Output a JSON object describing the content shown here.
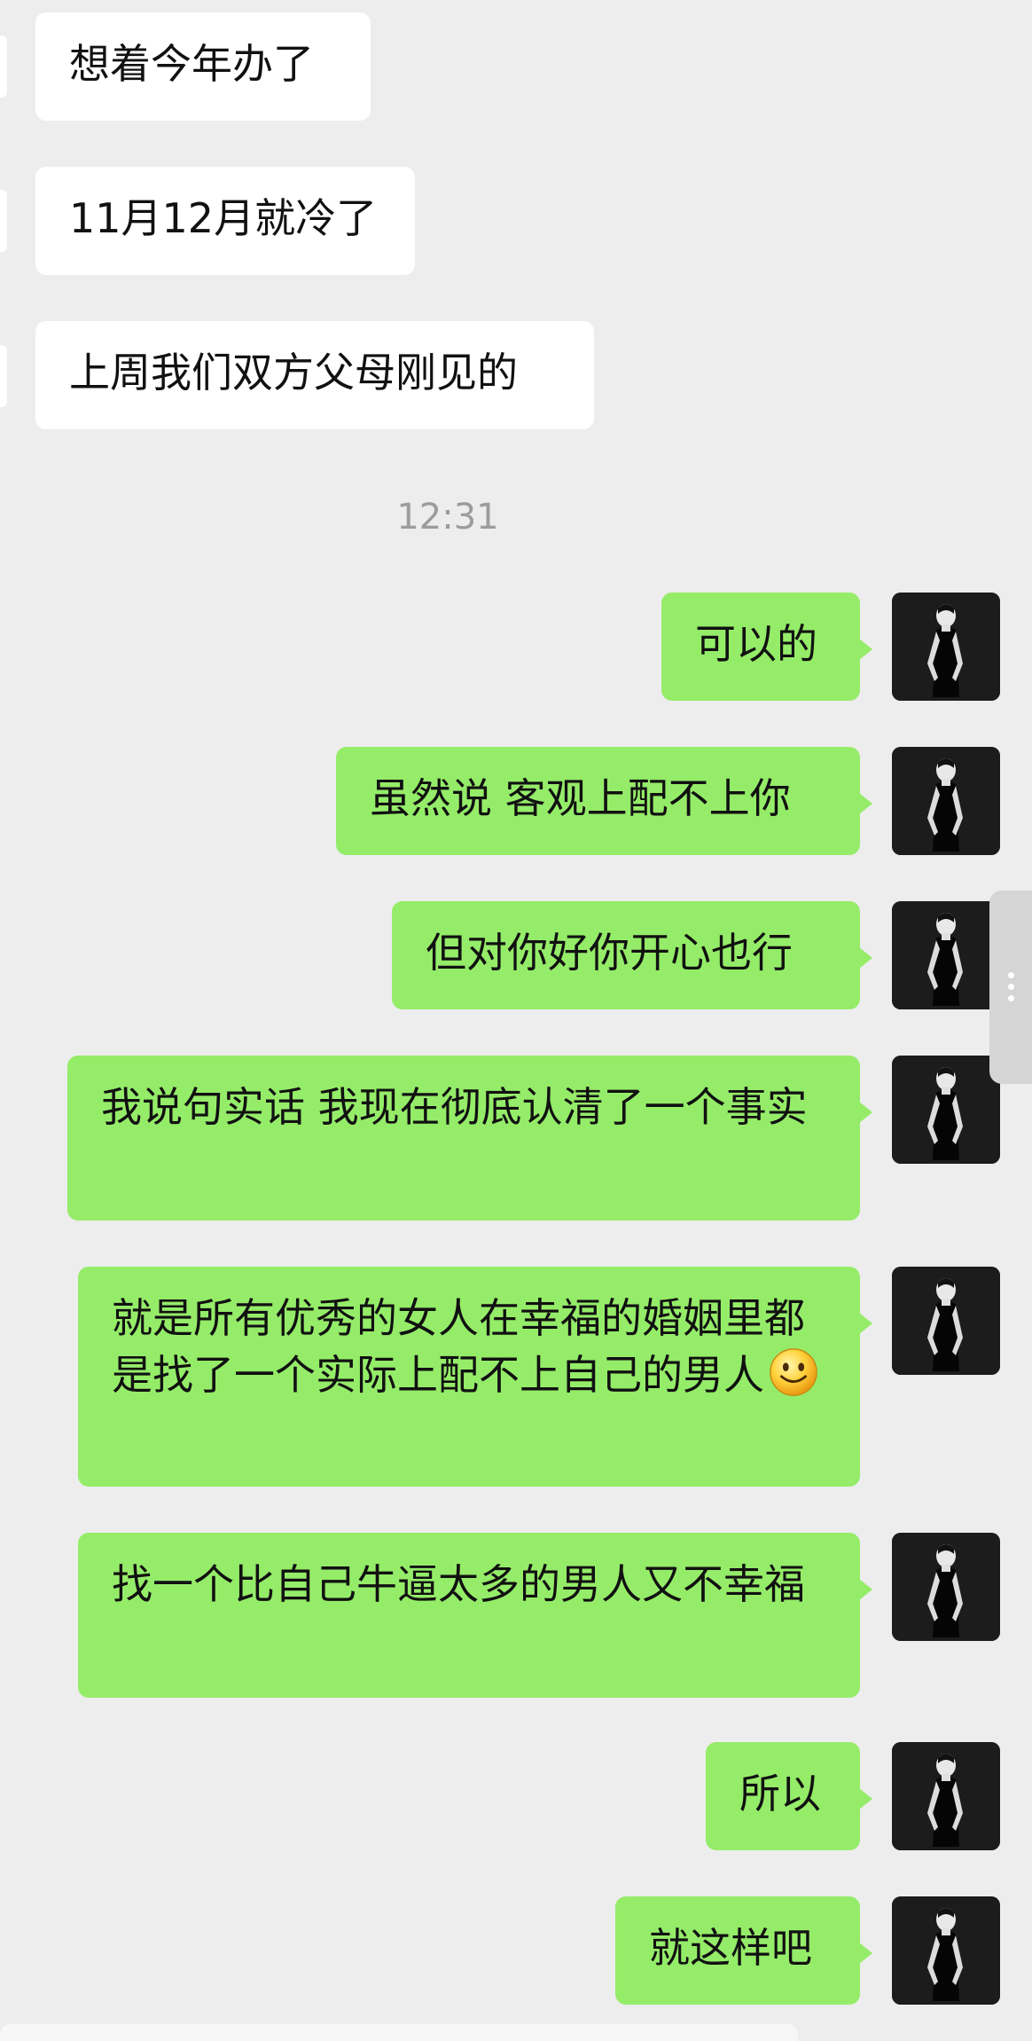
{
  "messages_in": [
    {
      "text": "想着今年办了"
    },
    {
      "text": "11月12月就冷了"
    },
    {
      "text": "上周我们双方父母刚见的"
    }
  ],
  "timestamp": "12:31",
  "messages_out": [
    {
      "text": "可以的"
    },
    {
      "text": "虽然说 客观上配不上你"
    },
    {
      "text": "但对你好你开心也行"
    },
    {
      "text": "我说句实话 我现在彻底认清了一个事实"
    },
    {
      "text": "就是所有优秀的女人在幸福的婚姻里都是找了一个实际上配不上自己的男人",
      "emoji": "smiling-face-emoji"
    },
    {
      "text": "找一个比自己牛逼太多的男人又不幸福"
    },
    {
      "text": "所以"
    },
    {
      "text": "就这样吧"
    }
  ],
  "colors": {
    "background": "#ededed",
    "incoming_bubble": "#ffffff",
    "outgoing_bubble": "#95ec69",
    "timestamp": "#9c9c9c"
  },
  "icons": {
    "avatar": "user-avatar-photo",
    "scroll": "scroll-handle-icon"
  }
}
